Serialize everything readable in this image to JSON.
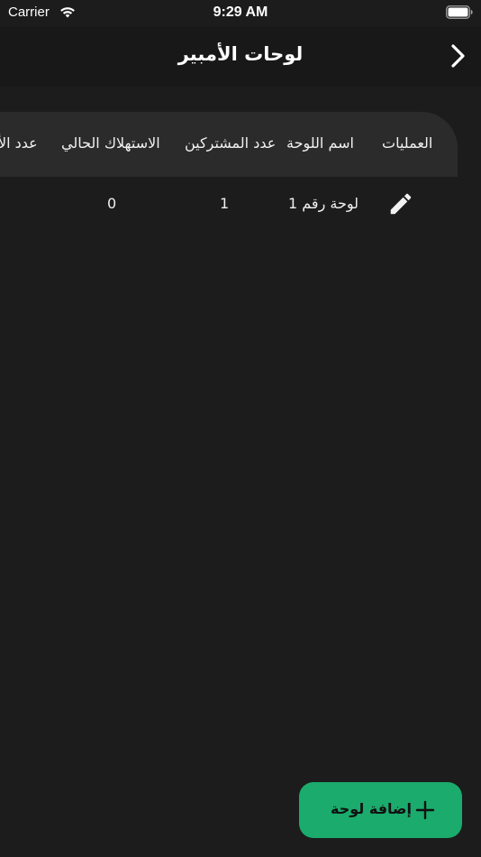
{
  "status_bar": {
    "carrier": "Carrier",
    "time": "9:29 AM"
  },
  "nav": {
    "title": "لوحات الأمبير",
    "back_icon": "chevron-right-icon"
  },
  "table": {
    "columns": [
      "العمليات",
      "اسم اللوحة",
      "عدد المشتركين",
      "الاستهلاك الحالي",
      "عدد الأ"
    ],
    "rows": [
      {
        "name": "لوحة رقم 1",
        "subscribers": "1",
        "consumption": "0",
        "action_icon": "pencil-icon"
      }
    ]
  },
  "fab": {
    "label": "إضافة لوحة",
    "icon": "plus-icon",
    "color": "#1aab6d"
  },
  "colors": {
    "background": "#1c1c1c",
    "nav_background": "#181818",
    "header_background": "#2b2b2b",
    "accent": "#1aab6d"
  }
}
